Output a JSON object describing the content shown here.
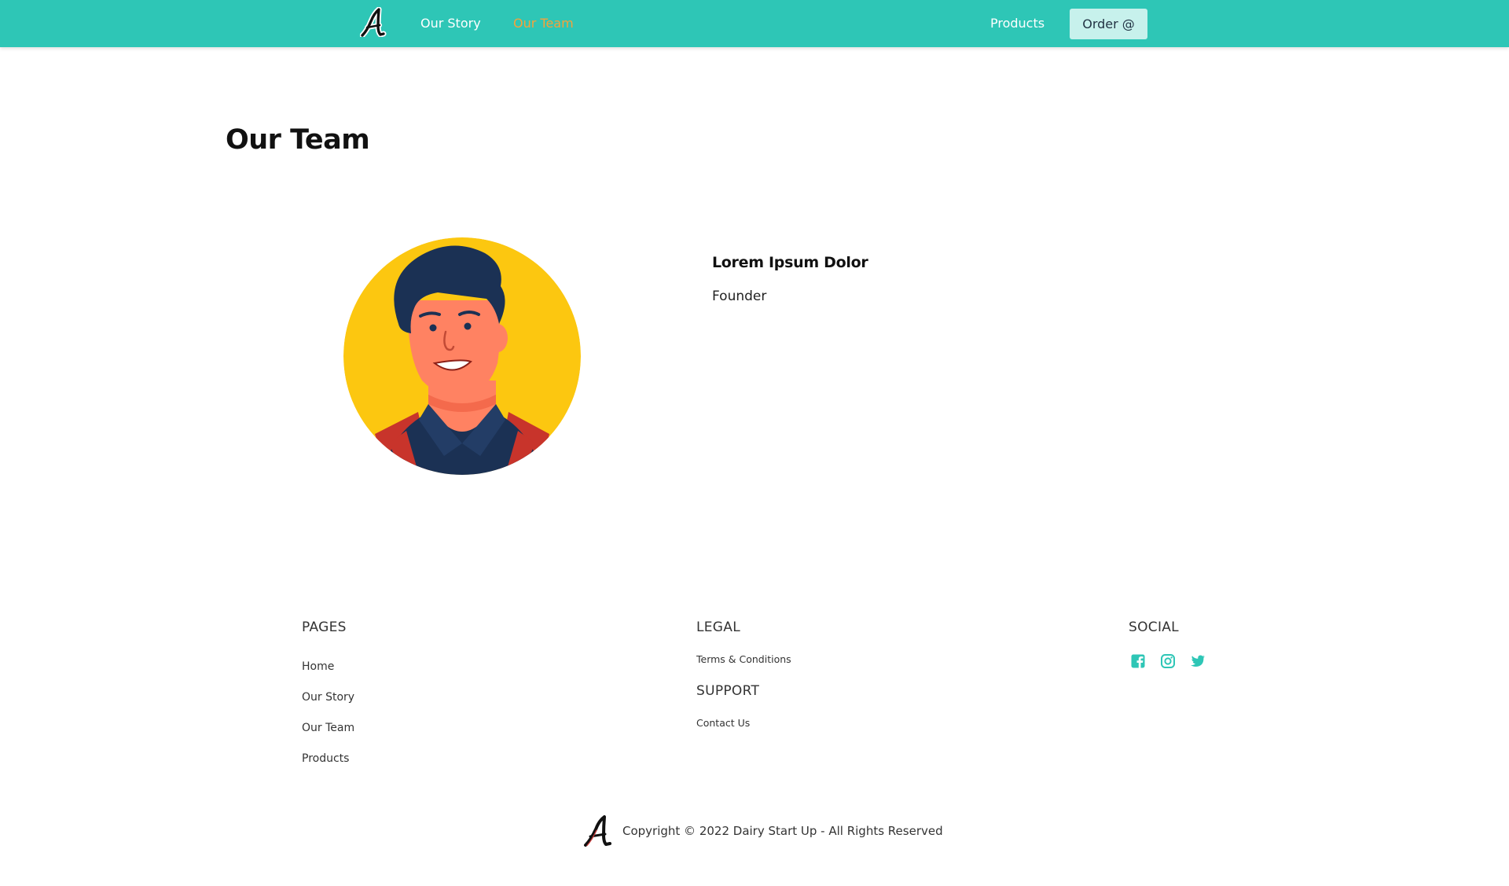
{
  "nav": {
    "links": [
      {
        "label": "Our Story"
      },
      {
        "label": "Our Team"
      },
      {
        "label": "Products"
      }
    ],
    "order_button": "Order @",
    "active_color": "#f6a23a",
    "bar_color": "#2ec6b6"
  },
  "main": {
    "title": "Our Team",
    "member": {
      "name": "Lorem Ipsum Dolor",
      "role": "Founder",
      "avatar": "man-illustration"
    }
  },
  "footer": {
    "pages": {
      "heading": "PAGES",
      "links": [
        "Home",
        "Our Story",
        "Our Team",
        "Products"
      ]
    },
    "legal": {
      "heading": "LEGAL",
      "links": [
        "Terms & Conditions"
      ]
    },
    "support": {
      "heading": "SUPPORT",
      "links": [
        "Contact Us"
      ]
    },
    "social": {
      "heading": "SOCIAL",
      "icons": [
        "facebook-icon",
        "instagram-icon",
        "twitter-icon"
      ],
      "icon_color": "#2ec6b6"
    },
    "copyright": "Copyright © 2022 Dairy Start Up - All Rights Reserved"
  }
}
